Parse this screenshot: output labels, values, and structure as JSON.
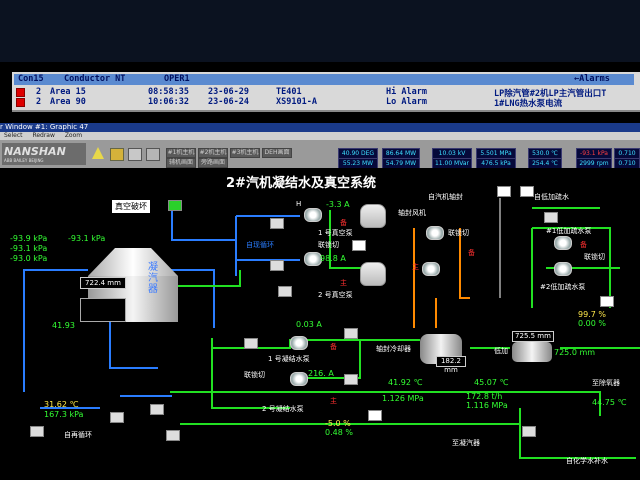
{
  "alarm": {
    "header": {
      "col1": "Con15",
      "col2": "Conductor NT",
      "col3": "OPER1",
      "col4": "←Alarms"
    },
    "rows": [
      {
        "n": "2",
        "area": "Area 15",
        "time": "08:58:35",
        "date": "23-06-29",
        "tag": "TE401",
        "type": "Hi Alarm",
        "desc": "LP除汽管#2机LP主汽管出口T"
      },
      {
        "n": "2",
        "area": "Area 90",
        "time": "10:06:32",
        "date": "23-06-24",
        "tag": "XS9101-A",
        "type": "Lo Alarm",
        "desc": "1#LNG热水泵电流"
      }
    ]
  },
  "window": {
    "title": "r Window #1: Graphic 47",
    "menu": [
      "Select",
      "Redraw",
      "Zoom"
    ]
  },
  "logo": {
    "brand": "NANSHAN",
    "sub": "ABB BAILEY BEIJING"
  },
  "nav_buttons": [
    "#1机主机",
    "#2机主机",
    "#3机主机",
    "DEH画面",
    "辅机画面",
    "旁路画面"
  ],
  "readouts_top": [
    "40.90 DEG",
    "86.64 MW",
    "10.03 kV",
    "5.501 MPa",
    "530.0 ℃",
    "-93.1 kPa",
    "0.710"
  ],
  "readouts_bottom": [
    "55.23 MW",
    "54.79 MW",
    "11.00 MVar",
    "476.5 kPa",
    "254.4 ℃",
    "2999 rpm",
    "0.710"
  ],
  "title": "2#汽机凝结水及真空系统",
  "labels": {
    "vacuum_break": "真空破坏",
    "condenser": "凝汽器",
    "vp1": "1 号真空泵",
    "vp2": "2 号真空泵",
    "interlock": "联锁切",
    "interlock2": "联锁切",
    "interlock3": "联锁切",
    "backup": "备",
    "main": "主",
    "recirc": "自现循环",
    "aux_fan": "轴封风机",
    "turb_seal": "自汽机轴封",
    "lp_htr": "自低加疏水",
    "lp_drain1": "#1低加疏水泵",
    "lp_drain2": "#2低加疏水泵",
    "cp1": "1 号凝结水泵",
    "cp2": "2 号凝结水泵",
    "gland_cooler": "轴封冷却器",
    "lp": "低加",
    "to_deaer": "至除氧器",
    "to_condenser": "至凝汽器",
    "self_recirc": "自再循环",
    "chem_makeup": "自化学水补水",
    "h": "H"
  },
  "values": {
    "p1": "-93.9 kPa",
    "p2": "-93.1 kPa",
    "p3": "-93.1 kPa",
    "p4": "-93.0 kPa",
    "level_cond": "722.4 mm",
    "t1": "41.93",
    "vp1_amp": "-3.3 A",
    "vp2_amp": "98.8 A",
    "cp1_amp": "0.03 A",
    "cp2_amp": "216. A",
    "t2": "31.62 ℃",
    "p5": "167.3 kPa",
    "t3": "41.92 ℃",
    "t4": "45.07 ℃",
    "p6": "1.126 MPa",
    "flow": "172.8 t/h",
    "p7": "1.116 MPa",
    "gland_level": "182.2 mm",
    "lp_level": "725.5 mm",
    "lp_level2": "725.0 mm",
    "pct1": "99.7 %",
    "pct2": "0.00 %",
    "t5": "44.75 ℃",
    "pct3": "-5.0 %",
    "pct4": "0.48 %"
  },
  "colors": {
    "pipe_green": "#22e022",
    "pipe_blue": "#2a7dff",
    "pipe_orange": "#ff8a00",
    "text_title": "#ffffff"
  }
}
